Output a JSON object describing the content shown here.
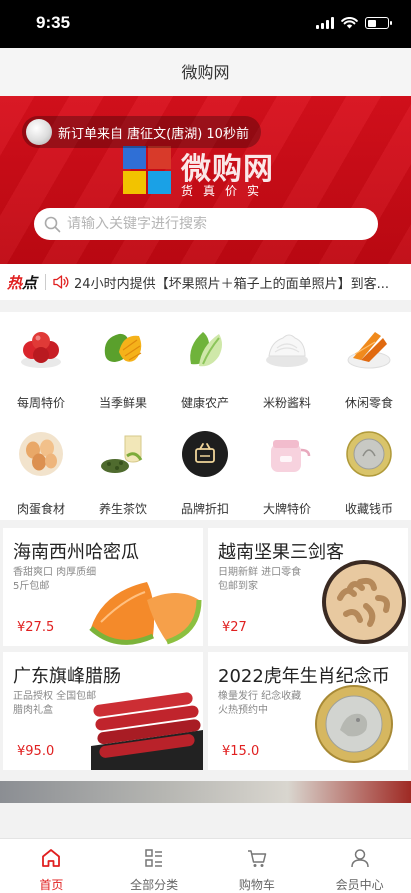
{
  "status_bar": {
    "time": "9:35"
  },
  "header": {
    "title": "微购网"
  },
  "banner": {
    "order_notice": "新订单来自 唐征文(唐湖) 10秒前",
    "logo_text": "微购网",
    "logo_slogan": "货真价实",
    "logo_colors": [
      "#2f6fd6",
      "#d83a2a",
      "#f2c300",
      "#1aa1e6"
    ]
  },
  "search": {
    "placeholder": "请输入关键字进行搜索"
  },
  "hot": {
    "label_part1": "热",
    "label_part2": "点",
    "text": "24小时内提供【坏果照片＋箱子上的面单照片】到客..."
  },
  "categories": [
    {
      "label": "每周特价",
      "icon": "apples-icon"
    },
    {
      "label": "当季鲜果",
      "icon": "mango-icon"
    },
    {
      "label": "健康农产",
      "icon": "vegetable-icon"
    },
    {
      "label": "米粉酱料",
      "icon": "rice-noodle-icon"
    },
    {
      "label": "休闲零食",
      "icon": "snack-icon"
    },
    {
      "label": "肉蛋食材",
      "icon": "eggs-icon"
    },
    {
      "label": "养生茶饮",
      "icon": "tea-icon"
    },
    {
      "label": "品牌折扣",
      "icon": "brand-icon"
    },
    {
      "label": "大牌特价",
      "icon": "cooker-icon"
    },
    {
      "label": "收藏钱币",
      "icon": "coin-icon"
    }
  ],
  "products": [
    {
      "title": "海南西州哈密瓜",
      "desc": "香甜爽口 肉厚质细 5斤包邮",
      "price": "¥27.5"
    },
    {
      "title": "越南坚果三剑客",
      "desc": "日期新鲜 进口零食 包邮到家",
      "price": "¥27"
    },
    {
      "title": "广东旗峰腊肠",
      "desc": "正品授权 全国包邮 腊肉礼盒",
      "price": "¥95.0"
    },
    {
      "title": "2022虎年生肖纪念币",
      "desc": "橡量发行 纪念收藏 火热预约中",
      "price": "¥15.0"
    }
  ],
  "tabs": [
    {
      "label": "首页",
      "icon": "home-icon"
    },
    {
      "label": "全部分类",
      "icon": "category-icon"
    },
    {
      "label": "购物车",
      "icon": "cart-icon"
    },
    {
      "label": "会员中心",
      "icon": "user-icon"
    }
  ],
  "accent_color": "#e02020"
}
